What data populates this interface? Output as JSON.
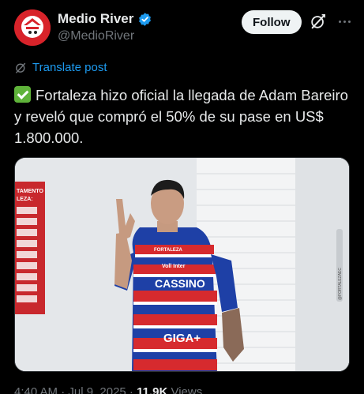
{
  "author": {
    "display_name": "Medio River",
    "handle": "@MedioRiver"
  },
  "actions": {
    "follow_label": "Follow"
  },
  "translate_label": "Translate post",
  "post": {
    "text": "Fortaleza hizo oficial la llegada de Adam Bareiro y reveló que compró el 50% de su pase en US$ 1.800.000."
  },
  "media": {
    "board_title_1": "TAMENTO",
    "board_title_2": "LEZA:",
    "jersey_brand_1": "FORTALEZA",
    "jersey_brand_2": "Voll Inter",
    "jersey_sponsor": "CASSINO",
    "jersey_sponsor_2": "GIGA+",
    "side_tag": "@FORTALEZAEC"
  },
  "footer": {
    "time": "4:40 AM · Jul 9, 2025 · ",
    "views_count": "11.9K",
    "views_label": " Views"
  },
  "colors": {
    "accent": "#1d9bf0",
    "verified": "#1d9bf0",
    "check_emoji": "#5fb33a"
  },
  "icons": [
    "verified-badge-icon",
    "grok-icon",
    "more-icon",
    "translate-icon",
    "check-emoji-icon"
  ]
}
